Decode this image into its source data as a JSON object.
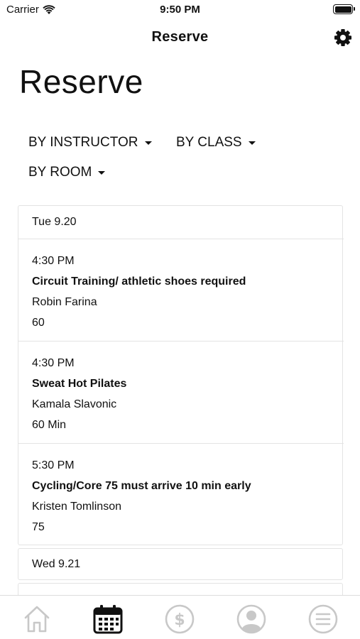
{
  "status": {
    "carrier": "Carrier",
    "time": "9:50 PM"
  },
  "nav": {
    "title": "Reserve"
  },
  "page": {
    "title": "Reserve"
  },
  "filters": [
    {
      "label": "BY INSTRUCTOR"
    },
    {
      "label": "BY CLASS"
    },
    {
      "label": "BY ROOM"
    }
  ],
  "days": [
    {
      "label": "Tue 9.20",
      "sessions": [
        {
          "time": "4:30 PM",
          "title": "Circuit Training/ athletic shoes required",
          "instructor": "Robin Farina",
          "duration": "60"
        },
        {
          "time": "4:30 PM",
          "title": "Sweat Hot Pilates",
          "instructor": "Kamala Slavonic",
          "duration": "60 Min"
        },
        {
          "time": "5:30 PM",
          "title": "Cycling/Core 75 must arrive 10 min early",
          "instructor": "Kristen Tomlinson",
          "duration": "75"
        }
      ]
    },
    {
      "label": "Wed 9.21",
      "sessions": []
    }
  ],
  "tabs": [
    {
      "icon": "home-icon",
      "active": false
    },
    {
      "icon": "calendar-icon",
      "active": true
    },
    {
      "icon": "dollar-icon",
      "active": false
    },
    {
      "icon": "profile-icon",
      "active": false
    },
    {
      "icon": "menu-icon",
      "active": false
    }
  ],
  "colors": {
    "active_tab": "#111111",
    "inactive_tab": "#c8c8c8",
    "card_border": "#e3e3e3"
  }
}
